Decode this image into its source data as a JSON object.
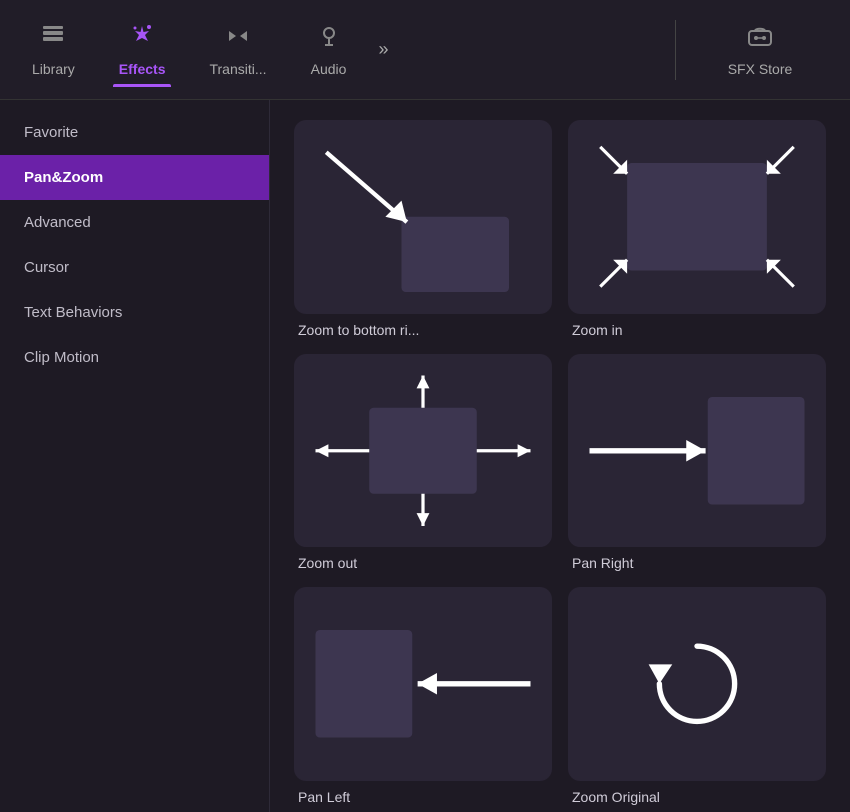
{
  "nav": {
    "items": [
      {
        "id": "library",
        "label": "Library",
        "icon": "layers",
        "active": false
      },
      {
        "id": "effects",
        "label": "Effects",
        "icon": "sparkles",
        "active": true
      },
      {
        "id": "transitions",
        "label": "Transiti...",
        "icon": "transitions",
        "active": false
      },
      {
        "id": "audio",
        "label": "Audio",
        "icon": "audio",
        "active": false
      }
    ],
    "more_icon": "»",
    "right_item": {
      "label": "SFX Store",
      "icon": "sfx"
    }
  },
  "sidebar": {
    "items": [
      {
        "id": "favorite",
        "label": "Favorite",
        "active": false
      },
      {
        "id": "panzoom",
        "label": "Pan&Zoom",
        "active": true
      },
      {
        "id": "advanced",
        "label": "Advanced",
        "active": false
      },
      {
        "id": "cursor",
        "label": "Cursor",
        "active": false
      },
      {
        "id": "text-behaviors",
        "label": "Text Behaviors",
        "active": false
      },
      {
        "id": "clip-motion",
        "label": "Clip Motion",
        "active": false
      }
    ]
  },
  "effects": [
    {
      "id": "zoom-bottom-right",
      "label": "Zoom to bottom ri...",
      "type": "zoom-bottom-right"
    },
    {
      "id": "zoom-in",
      "label": "Zoom in",
      "type": "zoom-in"
    },
    {
      "id": "zoom-out",
      "label": "Zoom out",
      "type": "zoom-out"
    },
    {
      "id": "pan-right",
      "label": "Pan Right",
      "type": "pan-right"
    },
    {
      "id": "pan-left",
      "label": "Pan Left",
      "type": "pan-left"
    },
    {
      "id": "zoom-original",
      "label": "Zoom Original",
      "type": "zoom-original"
    }
  ],
  "colors": {
    "active_nav": "#a855f7",
    "active_sidebar": "#6b21a8",
    "thumb_bg": "#2a2535",
    "rect_color": "#3d3650"
  }
}
